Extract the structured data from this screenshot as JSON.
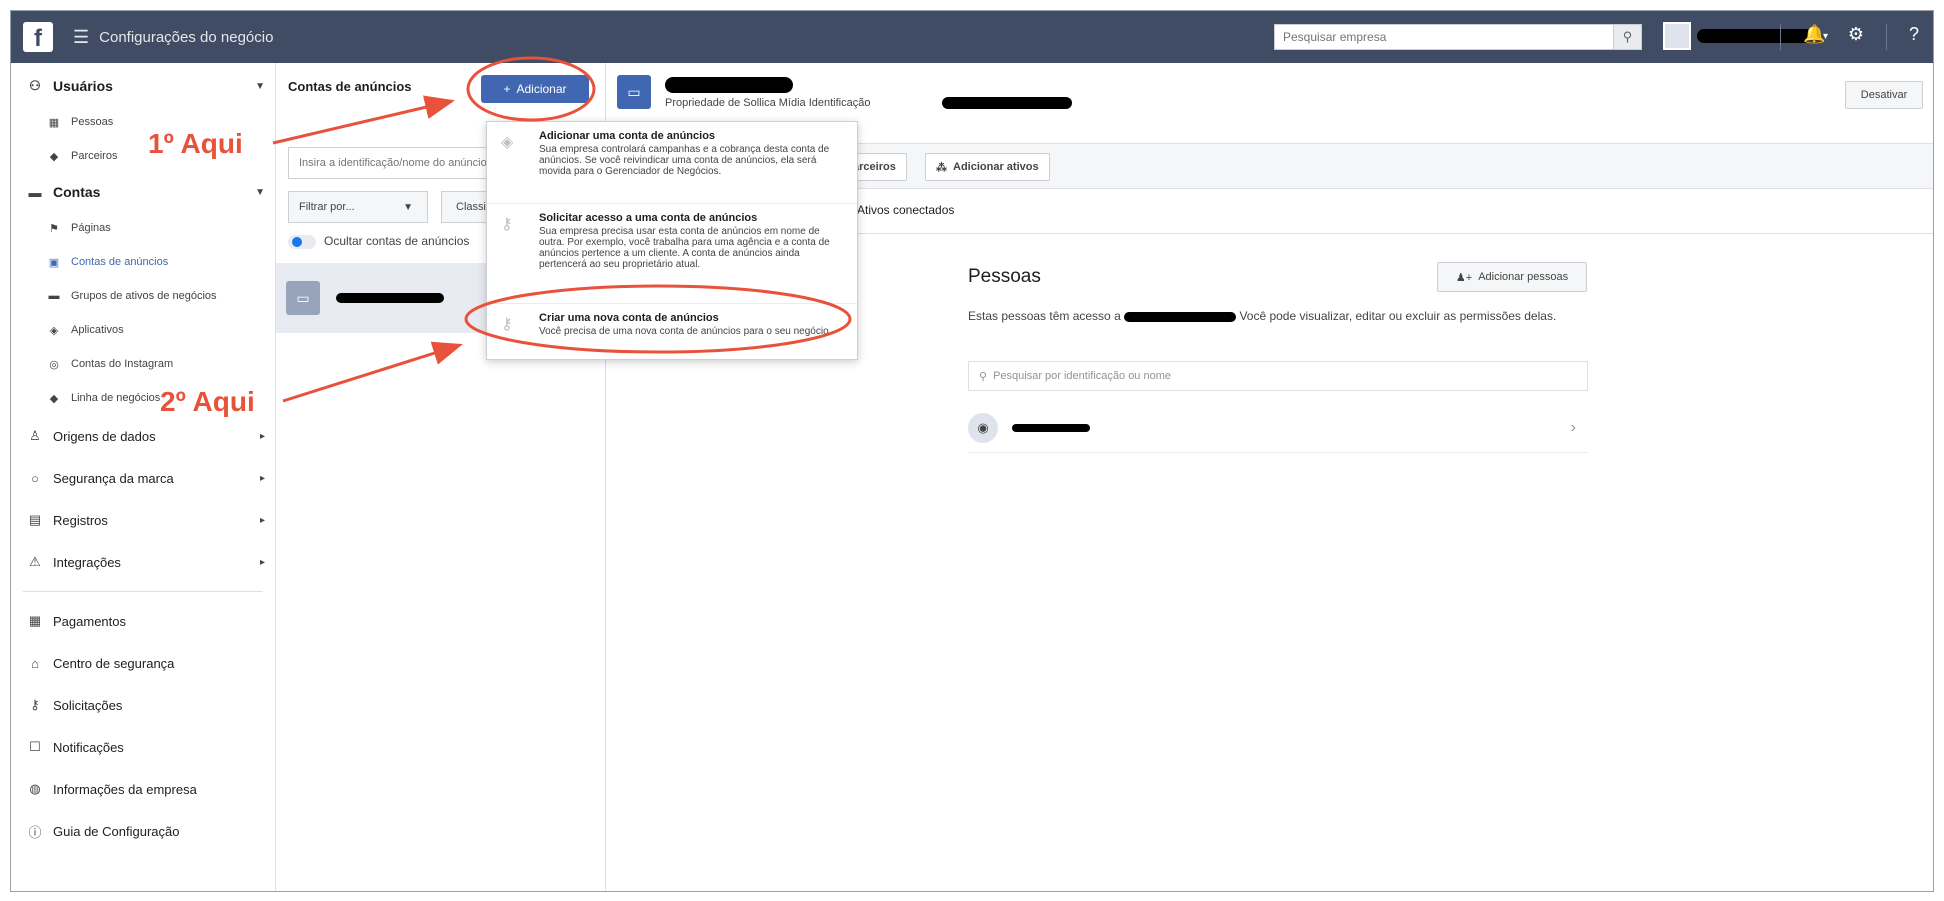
{
  "topbar": {
    "app_title": "Configurações do negócio",
    "search_placeholder": "Pesquisar empresa"
  },
  "nav": {
    "users_section": "Usuários",
    "users_items": [
      {
        "label": "Pessoas",
        "icon": "people-icon"
      },
      {
        "label": "Parceiros",
        "icon": "handshake-icon"
      }
    ],
    "accounts_section": "Contas",
    "accounts_items": [
      {
        "label": "Páginas",
        "icon": "flag-icon"
      },
      {
        "label": "Contas de anúncios",
        "icon": "ad-account-icon"
      },
      {
        "label": "Grupos de ativos de negócios",
        "icon": "folder-icon"
      },
      {
        "label": "Aplicativos",
        "icon": "cube-icon"
      },
      {
        "label": "Contas do Instagram",
        "icon": "instagram-icon"
      },
      {
        "label": "Linha de negócios",
        "icon": "briefcase-icon"
      }
    ],
    "sections": [
      {
        "label": "Origens de dados",
        "icon": "data-icon"
      },
      {
        "label": "Segurança da marca",
        "icon": "shield-icon"
      },
      {
        "label": "Registros",
        "icon": "registry-icon"
      },
      {
        "label": "Integrações",
        "icon": "integration-icon"
      }
    ],
    "bottom_items": [
      {
        "label": "Pagamentos",
        "icon": "payments-icon"
      },
      {
        "label": "Centro de segurança",
        "icon": "lock-icon"
      },
      {
        "label": "Solicitações",
        "icon": "key-icon"
      },
      {
        "label": "Notificações",
        "icon": "notifications-icon"
      },
      {
        "label": "Informações da empresa",
        "icon": "info-icon"
      },
      {
        "label": "Guia de Configuração",
        "icon": "guide-icon"
      }
    ]
  },
  "middle": {
    "title": "Contas de anúncios",
    "add_button": "Adicionar",
    "search_placeholder": "Insira a identificação/nome do anúncio",
    "filter_label": "Filtrar por...",
    "classify_label": "Classificar",
    "toggle_label": "Ocultar contas de anúncios"
  },
  "detail": {
    "subtitle": "Propriedade de Sollica Mídia  Identificação",
    "deactivate_button": "Desativar",
    "partners_button": "arceiros",
    "add_assets_button": "Adicionar ativos",
    "connected_tab": "Ativos conectados",
    "people_title": "Pessoas",
    "add_people_button": "Adicionar pessoas",
    "people_desc_before": "Estas pessoas têm acesso a",
    "people_desc_after": "Você pode visualizar, editar ou excluir as permissões delas.",
    "people_search_placeholder": "Pesquisar por identificação ou nome"
  },
  "dropdown": {
    "items": [
      {
        "title": "Adicionar uma conta de anúncios",
        "desc": "Sua empresa controlará campanhas e a cobrança desta conta de anúncios. Se você reivindicar uma conta de anúncios, ela será movida para o Gerenciador de Negócios.",
        "icon": "tag-icon"
      },
      {
        "title": "Solicitar acesso a uma conta de anúncios",
        "desc": "Sua empresa precisa usar esta conta de anúncios em nome de outra. Por exemplo, você trabalha para uma agência e a conta de anúncios pertence a um cliente. A conta de anúncios ainda pertencerá ao seu proprietário atual.",
        "icon": "key-icon"
      },
      {
        "title": "Criar uma nova conta de anúncios",
        "desc": "Você precisa de uma nova conta de anúncios para o seu negócio.",
        "icon": "key-icon"
      }
    ]
  },
  "annotations": {
    "first": "1º Aqui",
    "second": "2º Aqui",
    "color": "#e8523a"
  },
  "colors": {
    "topbar": "#3f4c63",
    "primary": "#4267b2"
  }
}
